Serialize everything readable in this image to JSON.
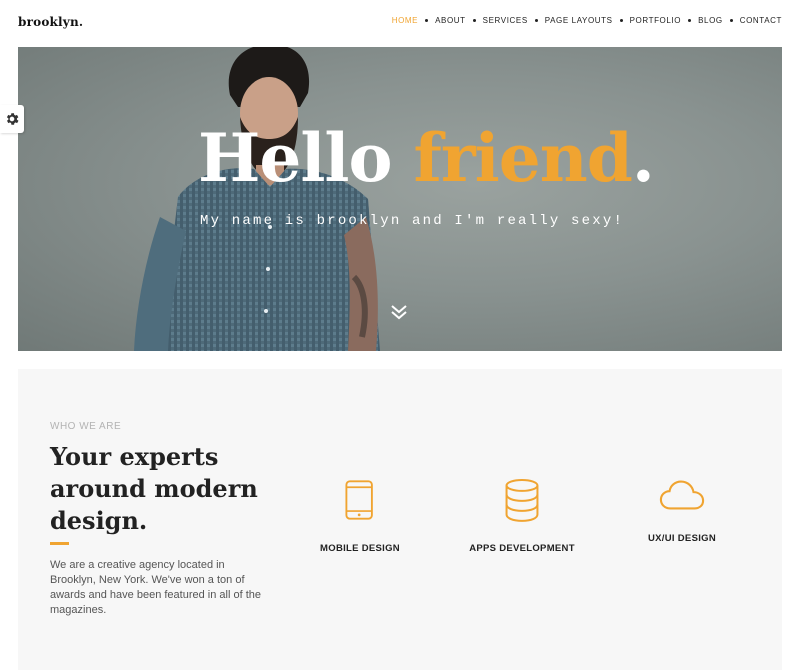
{
  "header": {
    "logo": "brooklyn.",
    "nav": [
      {
        "label": "HOME",
        "active": true
      },
      {
        "label": "ABOUT",
        "active": false
      },
      {
        "label": "SERVICES",
        "active": false
      },
      {
        "label": "PAGE LAYOUTS",
        "active": false
      },
      {
        "label": "PORTFOLIO",
        "active": false
      },
      {
        "label": "BLOG",
        "active": false
      },
      {
        "label": "CONTACT",
        "active": false
      }
    ]
  },
  "hero": {
    "title_word1": "Hello",
    "title_word2": "friend",
    "title_dot": ".",
    "subtitle": "My name is brooklyn and I'm really sexy!",
    "scroll_icon": "double-chevron-down-icon"
  },
  "settings": {
    "icon": "gear-icon"
  },
  "about": {
    "eyebrow": "WHO WE ARE",
    "title": "Your experts around modern design.",
    "text": "We are a creative agency located in Brooklyn, New York. We've won a ton of awards and have been featured in all of the magazines.",
    "services": [
      {
        "label": "MOBILE DESIGN",
        "icon": "smartphone-icon"
      },
      {
        "label": "APPS DEVELOPMENT",
        "icon": "database-icon"
      },
      {
        "label": "UX/UI DESIGN",
        "icon": "cloud-icon"
      }
    ]
  },
  "colors": {
    "accent": "#f0a431",
    "text_dark": "#222222",
    "section_bg": "#f7f7f7"
  }
}
